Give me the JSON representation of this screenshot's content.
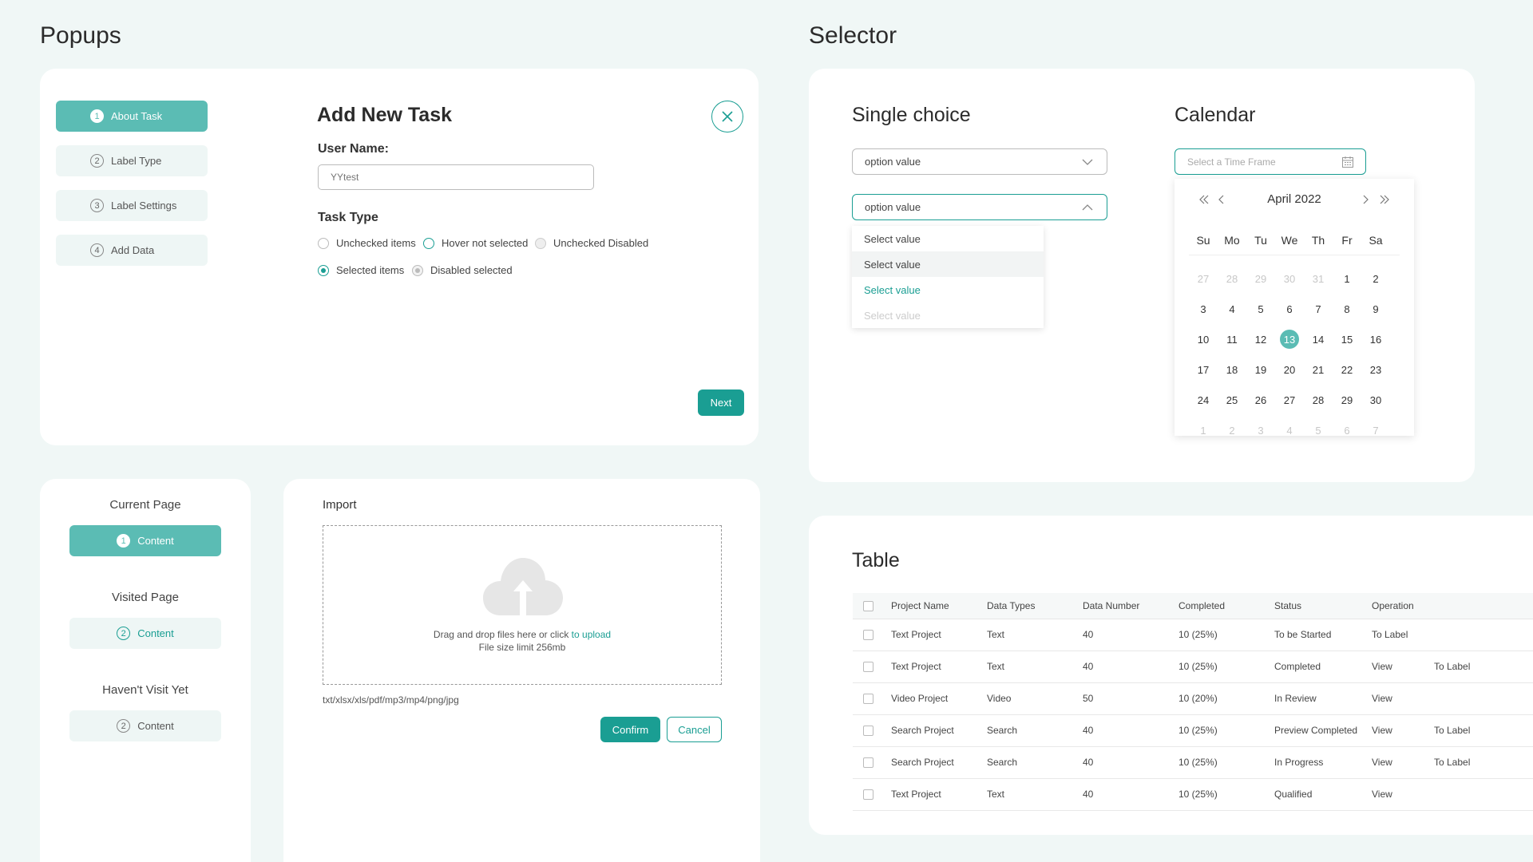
{
  "popups": {
    "section_title": "Popups",
    "steps": [
      {
        "num": "1",
        "label": "About Task"
      },
      {
        "num": "2",
        "label": "Label Type"
      },
      {
        "num": "3",
        "label": "Label Settings"
      },
      {
        "num": "4",
        "label": "Add Data"
      }
    ],
    "dialog_title": "Add New Task",
    "user_name_label": "User Name:",
    "user_name_placeholder": "YYtest",
    "task_type_label": "Task Type",
    "radios": [
      {
        "label": "Unchecked items"
      },
      {
        "label": "Hover not selected"
      },
      {
        "label": "Unchecked Disabled"
      },
      {
        "label": "Selected items"
      },
      {
        "label": "Disabled selected"
      }
    ],
    "next_label": "Next",
    "accent_color": "#1a9e93"
  },
  "pages": {
    "current_title": "Current Page",
    "current_item": {
      "num": "1",
      "label": "Content"
    },
    "visited_title": "Visited Page",
    "visited_item": {
      "num": "2",
      "label": "Content"
    },
    "notvisited_title": "Haven't Visit Yet",
    "notvisited_item": {
      "num": "2",
      "label": "Content"
    }
  },
  "import": {
    "title": "Import",
    "drop_text": "Drag and drop files here or click ",
    "upload_link": "to upload",
    "size_limit": "File size limit 256mb",
    "formats": "txt/xlsx/xls/pdf/mp3/mp4/png/jpg",
    "confirm_label": "Confirm",
    "cancel_label": "Cancel"
  },
  "selector": {
    "section_title": "Selector",
    "single_title": "Single choice",
    "select1_value": "option value",
    "select2_value": "option value",
    "options": [
      "Select value",
      "Select value",
      "Select value",
      "Select value"
    ],
    "calendar_title": "Calendar",
    "calendar_placeholder": "Select a Time Frame",
    "month_label": "April 2022",
    "weekdays": [
      "Su",
      "Mo",
      "Tu",
      "We",
      "Th",
      "Fr",
      "Sa"
    ],
    "weeks": [
      [
        "27",
        "28",
        "29",
        "30",
        "31",
        "1",
        "2"
      ],
      [
        "3",
        "4",
        "5",
        "6",
        "7",
        "8",
        "9"
      ],
      [
        "10",
        "11",
        "12",
        "13",
        "14",
        "15",
        "16"
      ],
      [
        "17",
        "18",
        "19",
        "20",
        "21",
        "22",
        "23"
      ],
      [
        "24",
        "25",
        "26",
        "27",
        "28",
        "29",
        "30"
      ],
      [
        "1",
        "2",
        "3",
        "4",
        "5",
        "6",
        "7"
      ]
    ],
    "selected_day": "13"
  },
  "table": {
    "title": "Table",
    "headers": [
      "Project Name",
      "Data Types",
      "Data Number",
      "Completed",
      "Status",
      "Operation"
    ],
    "rows": [
      {
        "name": "Text Project",
        "type": "Text",
        "number": "40",
        "completed": "10 (25%)",
        "status": "To be Started",
        "ops": [
          "To Label"
        ]
      },
      {
        "name": "Text Project",
        "type": "Text",
        "number": "40",
        "completed": "10 (25%)",
        "status": "Completed",
        "ops": [
          "View",
          "To Label"
        ]
      },
      {
        "name": "Video Project",
        "type": "Video",
        "number": "50",
        "completed": "10 (20%)",
        "status": "In Review",
        "ops": [
          "View"
        ]
      },
      {
        "name": "Search Project",
        "type": "Search",
        "number": "40",
        "completed": "10 (25%)",
        "status": "Preview Completed",
        "ops": [
          "View",
          "To Label"
        ]
      },
      {
        "name": "Search Project",
        "type": "Search",
        "number": "40",
        "completed": "10 (25%)",
        "status": "In Progress",
        "ops": [
          "View",
          "To Label"
        ]
      },
      {
        "name": "Text Project",
        "type": "Text",
        "number": "40",
        "completed": "10 (25%)",
        "status": "Qualified",
        "ops": [
          "View"
        ]
      }
    ]
  }
}
